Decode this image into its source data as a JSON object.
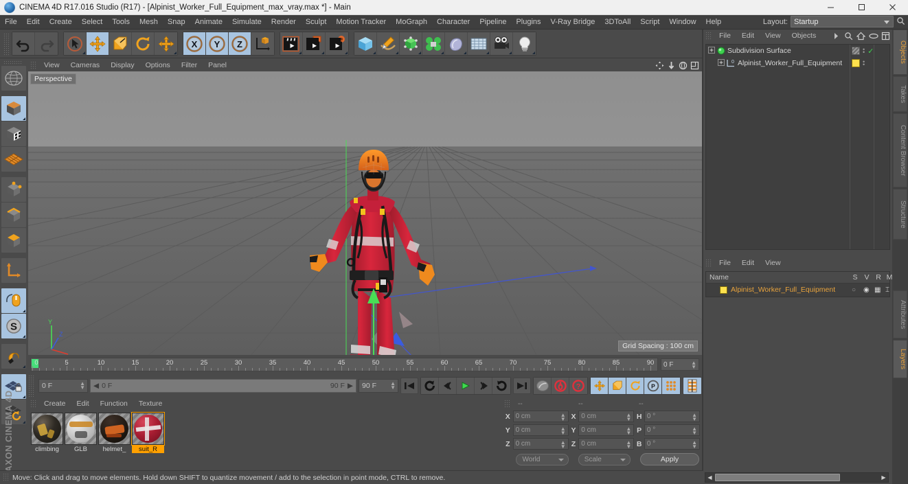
{
  "titlebar": {
    "title": "CINEMA 4D R17.016 Studio (R17) - [Alpinist_Worker_Full_Equipment_max_vray.max *] - Main",
    "app_icon": "c4d-logo-icon",
    "minimize": "–",
    "maximize": "□",
    "close": "✕"
  },
  "menubar": {
    "items": [
      "File",
      "Edit",
      "Create",
      "Select",
      "Tools",
      "Mesh",
      "Snap",
      "Animate",
      "Simulate",
      "Render",
      "Sculpt",
      "Motion Tracker",
      "MoGraph",
      "Character",
      "Pipeline",
      "Plugins",
      "V-Ray Bridge",
      "3DToAll",
      "Script",
      "Window",
      "Help"
    ],
    "layout_label": "Layout:",
    "layout_value": "Startup"
  },
  "toolbar": {
    "groups": [
      {
        "name": "history",
        "buttons": [
          {
            "name": "undo-button",
            "icon": "undo-arrow-icon",
            "selected": false
          },
          {
            "name": "redo-button",
            "icon": "redo-arrow-icon",
            "selected": false,
            "disabled": true
          }
        ]
      },
      {
        "name": "transform-tools",
        "buttons": [
          {
            "name": "live-selection-tool",
            "icon": "cursor-circle-icon",
            "selected": false
          },
          {
            "name": "move-tool",
            "icon": "move-arrows-icon",
            "selected": true
          },
          {
            "name": "scale-tool",
            "icon": "scale-box-icon",
            "selected": false
          },
          {
            "name": "rotate-tool",
            "icon": "rotate-arc-icon",
            "selected": false
          },
          {
            "name": "move-duplicate-tool",
            "icon": "move-arrows-icon",
            "selected": false
          }
        ]
      },
      {
        "name": "axis-locks",
        "buttons": [
          {
            "name": "x-axis-lock",
            "icon": "x-axis-icon",
            "selected": true
          },
          {
            "name": "y-axis-lock",
            "icon": "y-axis-icon",
            "selected": true
          },
          {
            "name": "z-axis-lock",
            "icon": "z-axis-icon",
            "selected": true
          },
          {
            "name": "world-object-coordinates",
            "icon": "axis-cube-icon",
            "selected": false
          }
        ]
      },
      {
        "name": "render-tools",
        "buttons": [
          {
            "name": "render-view-button",
            "icon": "clapper-icon",
            "selected": false
          },
          {
            "name": "render-region-button",
            "icon": "clapper-window-icon",
            "selected": false
          },
          {
            "name": "render-settings-button",
            "icon": "clapper-gear-icon",
            "selected": false
          }
        ]
      },
      {
        "name": "create-objects",
        "buttons": [
          {
            "name": "add-cube-button",
            "icon": "blue-cube-icon",
            "selected": false
          },
          {
            "name": "add-spline-button",
            "icon": "pen-spline-icon",
            "selected": false
          },
          {
            "name": "add-generator-button",
            "icon": "green-cube-icon",
            "selected": false
          },
          {
            "name": "add-deformer-button",
            "icon": "green-cluster-icon",
            "selected": false
          },
          {
            "name": "add-environment-button",
            "icon": "sky-blob-icon",
            "selected": false
          },
          {
            "name": "add-floor-button",
            "icon": "floor-grid-icon",
            "selected": false
          },
          {
            "name": "add-camera-button",
            "icon": "camera-icon",
            "selected": false
          },
          {
            "name": "add-light-button",
            "icon": "lightbulb-icon",
            "selected": false
          }
        ]
      }
    ]
  },
  "lefttool": {
    "buttons": [
      {
        "name": "undo-view-button",
        "icon": "globe-sphere-icon",
        "selected": false
      },
      {
        "name": "make-editable-button",
        "icon": "gray-cube-icon",
        "selected": true
      },
      {
        "name": "model-mode-button",
        "icon": "checker-cube-icon",
        "selected": false
      },
      {
        "name": "texture-mode-button",
        "icon": "orange-grid-icon",
        "selected": false
      },
      {
        "name": "points-mode-button",
        "icon": "cube-points-icon",
        "selected": false
      },
      {
        "name": "edges-mode-button",
        "icon": "cube-edges-icon",
        "selected": false
      },
      {
        "name": "polygons-mode-button",
        "icon": "cube-polygon-icon",
        "selected": false
      },
      {
        "name": "axis-modify-button",
        "icon": "axis-arrows-icon",
        "selected": false
      },
      {
        "name": "viewport-solo-button",
        "icon": "mouse-icon",
        "selected": true
      },
      {
        "name": "enable-snap-button",
        "icon": "s-circle-icon",
        "selected": true
      },
      {
        "name": "magnet-tool-button",
        "icon": "magnet-icon",
        "selected": false
      },
      {
        "name": "workplane-lock-button",
        "icon": "plane-lock-icon",
        "selected": true
      },
      {
        "name": "workplane-rotate-button",
        "icon": "plane-rotate-icon",
        "selected": false
      }
    ],
    "brand_line1": "MAXON",
    "brand_line2": "CINEMA 4D"
  },
  "viewport": {
    "menus": [
      "View",
      "Cameras",
      "Display",
      "Options",
      "Filter",
      "Panel"
    ],
    "label": "Perspective",
    "grid_spacing": "Grid Spacing : 100 cm",
    "nav_icons": [
      "pan-icon",
      "dolly-icon",
      "orbit-icon",
      "maximize-view-icon"
    ],
    "scene_object": "Alpinist_Worker_Full_Equipment",
    "axis_gizmo": {
      "x_color": "#e03c2e",
      "y_color": "#49dd55",
      "z_color": "#3b5ce0"
    }
  },
  "timeline": {
    "start": 0,
    "end": 90,
    "step": 5,
    "labels": [
      "0",
      "5",
      "10",
      "15",
      "20",
      "25",
      "30",
      "35",
      "40",
      "45",
      "50",
      "55",
      "60",
      "65",
      "70",
      "75",
      "80",
      "85",
      "90"
    ],
    "current_frame_field": "0 F",
    "playhead_frame": 0
  },
  "animbar": {
    "current_frame": "0 F",
    "range_start": "0 F",
    "range_end": "90 F",
    "end_frame": "90 F",
    "buttons": [
      {
        "name": "go-to-start-button",
        "icon": "skip-start-icon",
        "selected": false
      },
      {
        "name": "play-reverse-button",
        "icon": "loop-back-icon",
        "selected": false
      },
      {
        "name": "previous-frame-button",
        "icon": "step-back-icon",
        "selected": false
      },
      {
        "name": "play-button",
        "icon": "play-icon",
        "selected": false
      },
      {
        "name": "next-frame-button",
        "icon": "step-forward-icon",
        "selected": false
      },
      {
        "name": "play-forward-loop-button",
        "icon": "loop-forward-icon",
        "selected": false
      },
      {
        "name": "go-to-end-button",
        "icon": "skip-end-icon",
        "selected": false
      },
      {
        "name": "record-active-objects-button",
        "icon": "keyframe-gray-icon",
        "selected": false
      },
      {
        "name": "autokeying-button",
        "icon": "record-red-icon",
        "selected": false
      },
      {
        "name": "keyframe-selection-button",
        "icon": "question-red-icon",
        "selected": false
      },
      {
        "name": "position-key-button",
        "icon": "move-arrows-icon",
        "selected": true
      },
      {
        "name": "scale-key-button",
        "icon": "scale-box-icon",
        "selected": true
      },
      {
        "name": "rotation-key-button",
        "icon": "rotate-arc-icon",
        "selected": true
      },
      {
        "name": "parameter-key-button",
        "icon": "p-circle-icon",
        "selected": true
      },
      {
        "name": "point-level-animation-button",
        "icon": "dots-grid-icon",
        "selected": true
      },
      {
        "name": "timeline-toggle-button",
        "icon": "timeline-bars-icon",
        "selected": true
      }
    ]
  },
  "material_manager": {
    "menus": [
      "Create",
      "Edit",
      "Function",
      "Texture"
    ],
    "materials": [
      {
        "name": "climbing",
        "selected": false,
        "color": "#2a2520",
        "accent": "#c8a23c"
      },
      {
        "name": "GLB",
        "selected": false,
        "color": "#cfcfcf",
        "accent": "#c48a2a"
      },
      {
        "name": "helmet_",
        "selected": false,
        "color": "#2a2018",
        "accent": "#e06a22"
      },
      {
        "name": "suit_R",
        "selected": true,
        "color": "#b02434",
        "accent": "#e8e8e8"
      }
    ]
  },
  "coordinates": {
    "col_headers": [
      "--",
      "--",
      "--"
    ],
    "rows": [
      {
        "labels": [
          "X",
          "X",
          "H"
        ],
        "values": [
          "0 cm",
          "0 cm",
          "0 °"
        ]
      },
      {
        "labels": [
          "Y",
          "Y",
          "P"
        ],
        "values": [
          "0 cm",
          "0 cm",
          "0 °"
        ]
      },
      {
        "labels": [
          "Z",
          "Z",
          "B"
        ],
        "values": [
          "0 cm",
          "0 cm",
          "0 °"
        ]
      }
    ],
    "space_select": "World",
    "mode_select": "Scale",
    "apply_label": "Apply"
  },
  "object_manager": {
    "menus": [
      "File",
      "Edit",
      "View",
      "Objects"
    ],
    "overflow_icon": "chevron-right-icon",
    "tools": [
      "search-icon",
      "home-icon",
      "link-icon",
      "layout-icon"
    ],
    "rows": [
      {
        "name": "Subdivision Surface",
        "icon": "subdivision-surface-icon",
        "indent": 0,
        "tags": [
          "phong-tag-icon"
        ],
        "check": "✓"
      },
      {
        "name": "Alpinist_Worker_Full_Equipment",
        "icon": "polygon-object-icon",
        "indent": 1,
        "tags": [
          "material-tag-yellow"
        ],
        "check": ""
      }
    ]
  },
  "layer_manager": {
    "menus": [
      "File",
      "Edit",
      "View"
    ],
    "columns": [
      "Name",
      "S",
      "V",
      "R",
      "M"
    ],
    "rows": [
      {
        "name": "Alpinist_Worker_Full_Equipment",
        "swatch": "#ffe14d",
        "solo": "○",
        "view": "◉",
        "render": "▦",
        "manager": "⌶"
      }
    ]
  },
  "right_tabs": {
    "upper": [
      "Objects",
      "Takes",
      "Content Browser",
      "Structure"
    ],
    "lower": [
      "Attributes",
      "Layers"
    ],
    "active_upper": "Objects",
    "active_lower": "Layers"
  },
  "statusbar": {
    "text": "Move: Click and drag to move elements. Hold down SHIFT to quantize movement / add to the selection in point mode, CTRL to remove."
  },
  "colors": {
    "panel_bg": "#4a4a4a",
    "accent_orange": "#e8a33d",
    "selection_blue": "#a8c4e0",
    "highlight_yellow": "#ffa000"
  }
}
